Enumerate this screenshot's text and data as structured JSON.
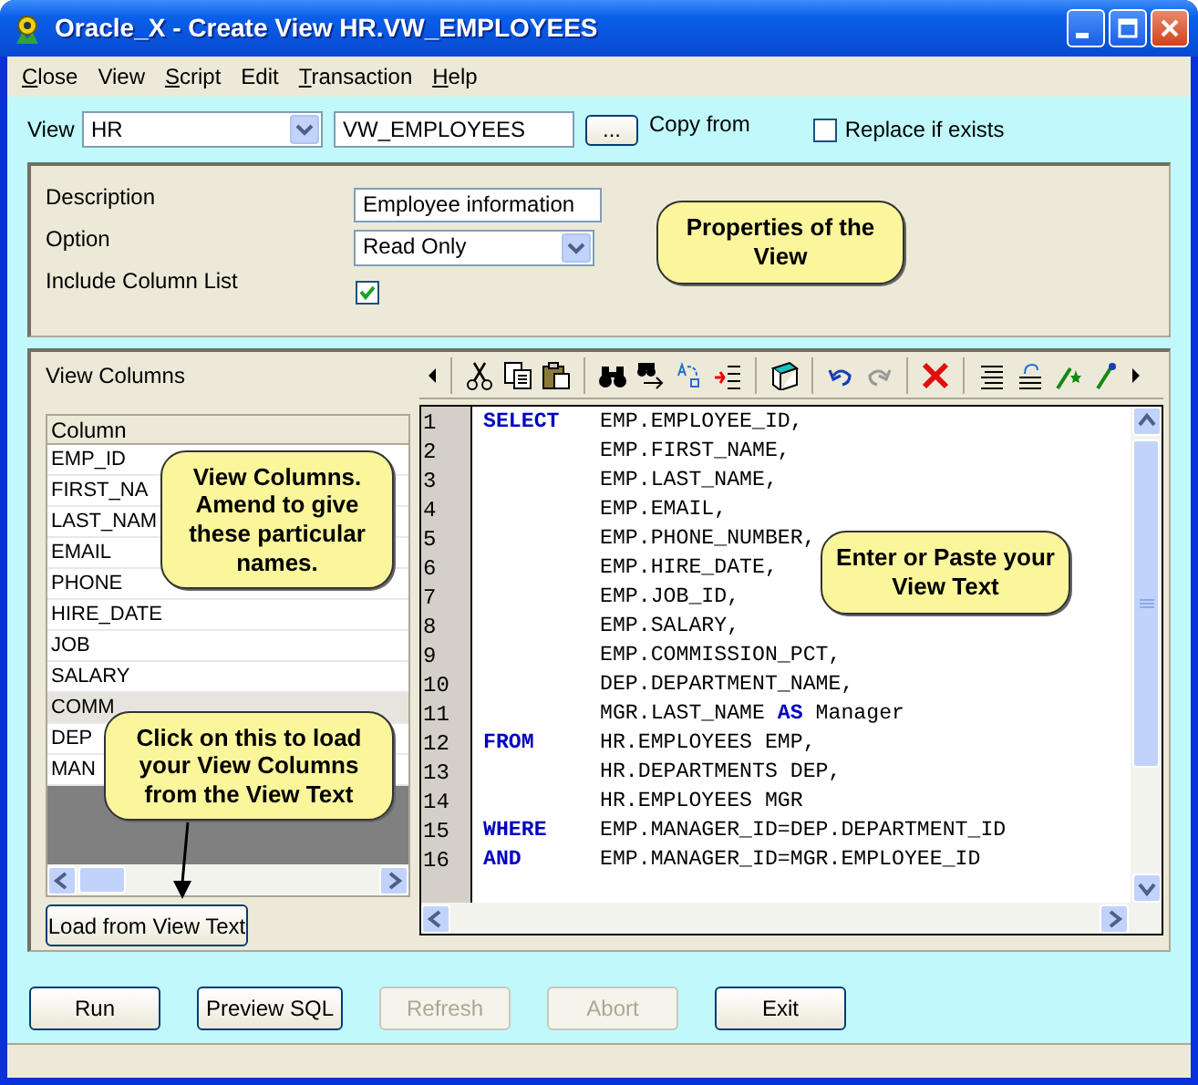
{
  "window": {
    "title": "Oracle_X - Create View HR.VW_EMPLOYEES"
  },
  "menu": [
    {
      "label": "Close",
      "accelerator_underlined": true
    },
    {
      "label": "View",
      "accelerator_underlined": false
    },
    {
      "label": "Script",
      "accelerator_underlined": true
    },
    {
      "label": "Edit",
      "accelerator_underlined": false
    },
    {
      "label": "Transaction",
      "accelerator_underlined": true
    },
    {
      "label": "Help",
      "accelerator_underlined": true
    }
  ],
  "view_row": {
    "label": "View",
    "schema": "HR",
    "name": "VW_EMPLOYEES",
    "browse_button": "...",
    "copy_from": "Copy from",
    "replace": {
      "label": "Replace if exists",
      "checked": false
    }
  },
  "properties": {
    "description": {
      "label": "Description",
      "value": "Employee information"
    },
    "option": {
      "label": "Option",
      "value": "Read Only"
    },
    "include_column_list": {
      "label": "Include Column List",
      "checked": true
    },
    "callout": "Properties of the View"
  },
  "view_columns": {
    "title": "View Columns",
    "header": "Column",
    "rows": [
      {
        "name": "EMP_ID",
        "selected": false
      },
      {
        "name": "FIRST_NA",
        "selected": false
      },
      {
        "name": "LAST_NAM",
        "selected": false
      },
      {
        "name": "EMAIL",
        "selected": false
      },
      {
        "name": "PHONE",
        "selected": false
      },
      {
        "name": "HIRE_DATE",
        "selected": false
      },
      {
        "name": "JOB",
        "selected": false
      },
      {
        "name": "SALARY",
        "selected": false
      },
      {
        "name": "COMM",
        "selected": true
      },
      {
        "name": "DEP",
        "selected": false
      },
      {
        "name": "MAN",
        "selected": false
      }
    ],
    "callouts": [
      "View Columns. Amend to give these particular names.",
      "Click on this to load your View Columns from the View Text"
    ],
    "load_button": "Load from View Text"
  },
  "editor": {
    "lines": [
      {
        "number": "1",
        "keyword": "SELECT",
        "code": "EMP.EMPLOYEE_ID,"
      },
      {
        "number": "2",
        "code": "EMP.FIRST_NAME,"
      },
      {
        "number": "3",
        "code": "EMP.LAST_NAME,"
      },
      {
        "number": "4",
        "code": "EMP.EMAIL,"
      },
      {
        "number": "5",
        "code": "EMP.PHONE_NUMBER,"
      },
      {
        "number": "6",
        "code": "EMP.HIRE_DATE,"
      },
      {
        "number": "7",
        "code": "EMP.JOB_ID,"
      },
      {
        "number": "8",
        "code": "EMP.SALARY,"
      },
      {
        "number": "9",
        "code": "EMP.COMMISSION_PCT,"
      },
      {
        "number": "10",
        "code": "DEP.DEPARTMENT_NAME,"
      },
      {
        "number": "11",
        "code": "MGR.LAST_NAME **AS** Manager"
      },
      {
        "number": "12",
        "keyword": "FROM",
        "code": "HR.EMPLOYEES EMP,"
      },
      {
        "number": "13",
        "code": "HR.DEPARTMENTS DEP,"
      },
      {
        "number": "14",
        "code": "HR.EMPLOYEES MGR"
      },
      {
        "number": "15",
        "keyword": "WHERE",
        "code": "EMP.MANAGER_ID=DEP.DEPARTMENT_ID"
      },
      {
        "number": "16",
        "keyword": "AND",
        "code": "EMP.MANAGER_ID=MGR.EMPLOYEE_ID"
      }
    ],
    "callout": "Enter or Paste your View Text"
  },
  "buttons": [
    {
      "label": "Run",
      "disabled": false
    },
    {
      "label": "Preview SQL",
      "disabled": false
    },
    {
      "label": "Refresh",
      "disabled": true
    },
    {
      "label": "Abort",
      "disabled": true
    },
    {
      "label": "Exit",
      "disabled": false
    }
  ]
}
